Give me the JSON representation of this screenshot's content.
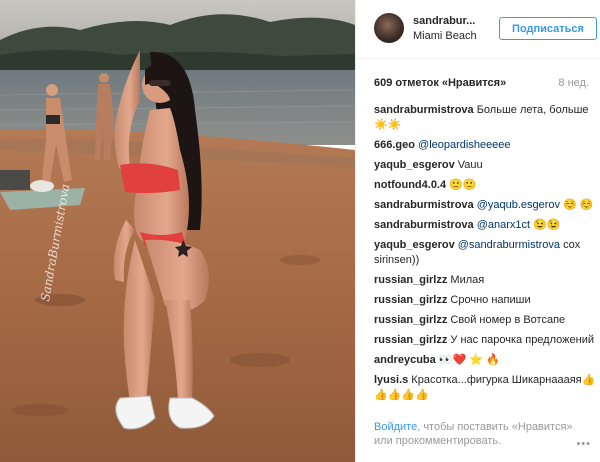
{
  "header": {
    "username": "sandrabur...",
    "location": "Miami Beach",
    "follow_label": "Подписаться"
  },
  "post": {
    "likes": "609 отметок «Нравится»",
    "age": "8 нед.",
    "watermark": "SandraBurmistrova"
  },
  "comments": [
    {
      "user": "sandraburmistrova",
      "text": " Больше лета, больше☀️☀️",
      "mention": ""
    },
    {
      "user": "666.geo",
      "text": "",
      "mention": " @leopardisheeeee"
    },
    {
      "user": "yaqub_esgerov",
      "text": " Vauu",
      "mention": ""
    },
    {
      "user": "notfound4.0.4",
      "text": " 🙂🙂",
      "mention": ""
    },
    {
      "user": "sandraburmistrova",
      "text": " ☺️ ☺️",
      "mention": " @yaqub.esgerov"
    },
    {
      "user": "sandraburmistrova",
      "text": " 😉😉",
      "mention": " @anarx1ct"
    },
    {
      "user": "yaqub_esgerov",
      "text": " cox sirinsen))",
      "mention": " @sandraburmistrova"
    },
    {
      "user": "russian_girlzz",
      "text": " Милая",
      "mention": ""
    },
    {
      "user": "russian_girlzz",
      "text": " Срочно напиши",
      "mention": ""
    },
    {
      "user": "russian_girlzz",
      "text": " Свой номер в Вотсапе",
      "mention": ""
    },
    {
      "user": "russian_girlzz",
      "text": " У нас парочка предложений",
      "mention": ""
    },
    {
      "user": "andreycuba",
      "text": " 👀❤️ ⭐ 🔥",
      "mention": ""
    },
    {
      "user": "lyusi.s",
      "text": " Красотка...фигурка Шикарнаааяя👍👍👍👍👍",
      "mention": ""
    }
  ],
  "footer": {
    "login_link": "Войдите",
    "rest": ", чтобы поставить «Нравится» или прокомментировать.",
    "more": "•••"
  },
  "colors": {
    "accent": "#3897f0",
    "text": "#262626",
    "muted": "#999999"
  }
}
